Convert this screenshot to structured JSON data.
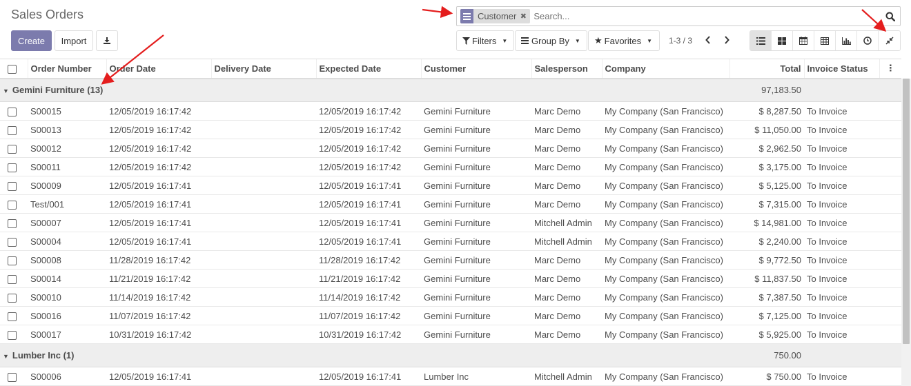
{
  "page": {
    "title": "Sales Orders",
    "create_label": "Create",
    "import_label": "Import",
    "download_icon": "download-icon"
  },
  "search": {
    "facet_label": "Customer",
    "facet_icon": "group-by-icon",
    "placeholder": "Search...",
    "value": ""
  },
  "toolbar": {
    "filters_label": "Filters",
    "groupby_label": "Group By",
    "favorites_label": "Favorites",
    "pager": "1-3 / 3",
    "views": [
      "list-view-icon",
      "kanban-view-icon",
      "calendar-view-icon",
      "pivot-view-icon",
      "graph-view-icon",
      "activity-view-icon",
      "fullscreen-toggle-icon"
    ],
    "active_view": "list-view-icon"
  },
  "colors": {
    "accent": "#7c7bad",
    "arrow": "#e41d1d"
  },
  "table": {
    "columns": [
      "Order Number",
      "Order Date",
      "Delivery Date",
      "Expected Date",
      "Customer",
      "Salesperson",
      "Company",
      "Total",
      "Invoice Status"
    ],
    "groups": [
      {
        "label": "Gemini Furniture (13)",
        "total": "97,183.50",
        "rows": [
          {
            "number": "S00015",
            "order_date": "12/05/2019 16:17:42",
            "delivery_date": "",
            "expected_date": "12/05/2019 16:17:42",
            "customer": "Gemini Furniture",
            "salesperson": "Marc Demo",
            "company": "My Company (San Francisco)",
            "total": "$ 8,287.50",
            "status": "To Invoice"
          },
          {
            "number": "S00013",
            "order_date": "12/05/2019 16:17:42",
            "delivery_date": "",
            "expected_date": "12/05/2019 16:17:42",
            "customer": "Gemini Furniture",
            "salesperson": "Marc Demo",
            "company": "My Company (San Francisco)",
            "total": "$ 11,050.00",
            "status": "To Invoice"
          },
          {
            "number": "S00012",
            "order_date": "12/05/2019 16:17:42",
            "delivery_date": "",
            "expected_date": "12/05/2019 16:17:42",
            "customer": "Gemini Furniture",
            "salesperson": "Marc Demo",
            "company": "My Company (San Francisco)",
            "total": "$ 2,962.50",
            "status": "To Invoice"
          },
          {
            "number": "S00011",
            "order_date": "12/05/2019 16:17:42",
            "delivery_date": "",
            "expected_date": "12/05/2019 16:17:42",
            "customer": "Gemini Furniture",
            "salesperson": "Marc Demo",
            "company": "My Company (San Francisco)",
            "total": "$ 3,175.00",
            "status": "To Invoice"
          },
          {
            "number": "S00009",
            "order_date": "12/05/2019 16:17:41",
            "delivery_date": "",
            "expected_date": "12/05/2019 16:17:41",
            "customer": "Gemini Furniture",
            "salesperson": "Marc Demo",
            "company": "My Company (San Francisco)",
            "total": "$ 5,125.00",
            "status": "To Invoice"
          },
          {
            "number": "Test/001",
            "order_date": "12/05/2019 16:17:41",
            "delivery_date": "",
            "expected_date": "12/05/2019 16:17:41",
            "customer": "Gemini Furniture",
            "salesperson": "Marc Demo",
            "company": "My Company (San Francisco)",
            "total": "$ 7,315.00",
            "status": "To Invoice"
          },
          {
            "number": "S00007",
            "order_date": "12/05/2019 16:17:41",
            "delivery_date": "",
            "expected_date": "12/05/2019 16:17:41",
            "customer": "Gemini Furniture",
            "salesperson": "Mitchell Admin",
            "company": "My Company (San Francisco)",
            "total": "$ 14,981.00",
            "status": "To Invoice"
          },
          {
            "number": "S00004",
            "order_date": "12/05/2019 16:17:41",
            "delivery_date": "",
            "expected_date": "12/05/2019 16:17:41",
            "customer": "Gemini Furniture",
            "salesperson": "Mitchell Admin",
            "company": "My Company (San Francisco)",
            "total": "$ 2,240.00",
            "status": "To Invoice"
          },
          {
            "number": "S00008",
            "order_date": "11/28/2019 16:17:42",
            "delivery_date": "",
            "expected_date": "11/28/2019 16:17:42",
            "customer": "Gemini Furniture",
            "salesperson": "Marc Demo",
            "company": "My Company (San Francisco)",
            "total": "$ 9,772.50",
            "status": "To Invoice"
          },
          {
            "number": "S00014",
            "order_date": "11/21/2019 16:17:42",
            "delivery_date": "",
            "expected_date": "11/21/2019 16:17:42",
            "customer": "Gemini Furniture",
            "salesperson": "Marc Demo",
            "company": "My Company (San Francisco)",
            "total": "$ 11,837.50",
            "status": "To Invoice"
          },
          {
            "number": "S00010",
            "order_date": "11/14/2019 16:17:42",
            "delivery_date": "",
            "expected_date": "11/14/2019 16:17:42",
            "customer": "Gemini Furniture",
            "salesperson": "Marc Demo",
            "company": "My Company (San Francisco)",
            "total": "$ 7,387.50",
            "status": "To Invoice"
          },
          {
            "number": "S00016",
            "order_date": "11/07/2019 16:17:42",
            "delivery_date": "",
            "expected_date": "11/07/2019 16:17:42",
            "customer": "Gemini Furniture",
            "salesperson": "Marc Demo",
            "company": "My Company (San Francisco)",
            "total": "$ 7,125.00",
            "status": "To Invoice"
          },
          {
            "number": "S00017",
            "order_date": "10/31/2019 16:17:42",
            "delivery_date": "",
            "expected_date": "10/31/2019 16:17:42",
            "customer": "Gemini Furniture",
            "salesperson": "Marc Demo",
            "company": "My Company (San Francisco)",
            "total": "$ 5,925.00",
            "status": "To Invoice"
          }
        ]
      },
      {
        "label": "Lumber Inc (1)",
        "total": "750.00",
        "rows": [
          {
            "number": "S00006",
            "order_date": "12/05/2019 16:17:41",
            "delivery_date": "",
            "expected_date": "12/05/2019 16:17:41",
            "customer": "Lumber Inc",
            "salesperson": "Mitchell Admin",
            "company": "My Company (San Francisco)",
            "total": "$ 750.00",
            "status": "To Invoice"
          }
        ]
      }
    ]
  }
}
